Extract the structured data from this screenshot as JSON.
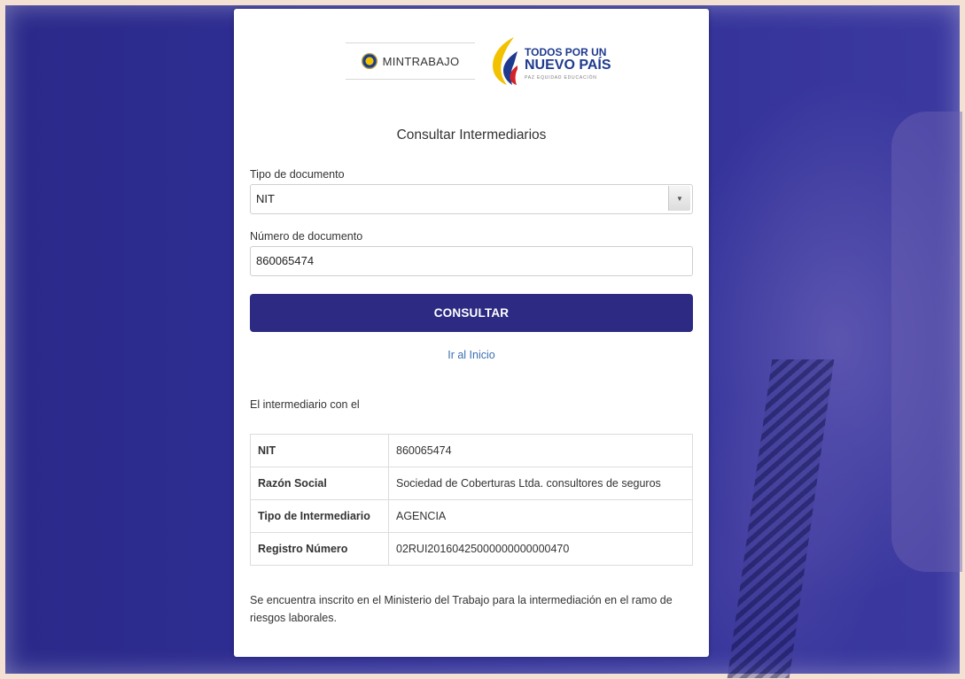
{
  "logos": {
    "ministry": "MINTRABAJO",
    "campaign_line1": "TODOS POR UN",
    "campaign_line2": "NUEVO PAÍS",
    "campaign_line3": "PAZ EQUIDAD EDUCACIÓN"
  },
  "form": {
    "title": "Consultar Intermediarios",
    "doc_type_label": "Tipo de documento",
    "doc_type_value": "NIT",
    "doc_number_label": "Número de documento",
    "doc_number_value": "860065474",
    "submit_label": "CONSULTAR",
    "home_link": "Ir al Inicio"
  },
  "result": {
    "intro": "El intermediario con el",
    "rows": [
      {
        "key": "NIT",
        "value": "860065474"
      },
      {
        "key": "Razón Social",
        "value": "Sociedad de Coberturas Ltda. consultores de seguros"
      },
      {
        "key": "Tipo de Intermediario",
        "value": "AGENCIA"
      },
      {
        "key": "Registro Número",
        "value": "02RUI20160425000000000000470"
      }
    ],
    "note": "Se encuentra inscrito en el Ministerio del Trabajo para la intermediación en el ramo de riesgos laborales."
  },
  "colors": {
    "primary": "#2c2a82",
    "link": "#3a6fb0",
    "background": "#2f2e95"
  },
  "icons": {
    "select_caret": "chevron-down-icon",
    "ministry_seal": "seal-icon"
  }
}
